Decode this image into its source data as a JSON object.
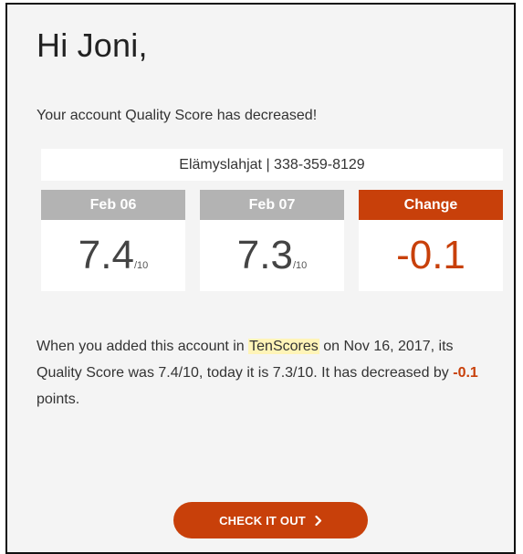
{
  "greeting": "Hi Joni,",
  "intro": "Your account Quality Score has decreased!",
  "account": "Elämyslahjat | 338-359-8129",
  "columns": {
    "prev": {
      "label": "Feb 06",
      "score": "7.4",
      "scale": "/10"
    },
    "curr": {
      "label": "Feb 07",
      "score": "7.3",
      "scale": "/10"
    },
    "change": {
      "label": "Change",
      "value": "-0.1"
    }
  },
  "description": {
    "part1": "When you added this account in ",
    "brand": "TenScores",
    "part2": " on Nov 16, 2017, its Quality Score was 7.4/10, today it is 7.3/10. It has decreased by ",
    "delta": "-0.1",
    "part3": " points."
  },
  "cta": {
    "label": "CHECK IT OUT",
    "icon": "chevron-right-icon"
  },
  "colors": {
    "accent": "#c8400a",
    "header_grey": "#b3b3b3",
    "highlight": "#fff4b8",
    "background": "#f4f4f4"
  }
}
